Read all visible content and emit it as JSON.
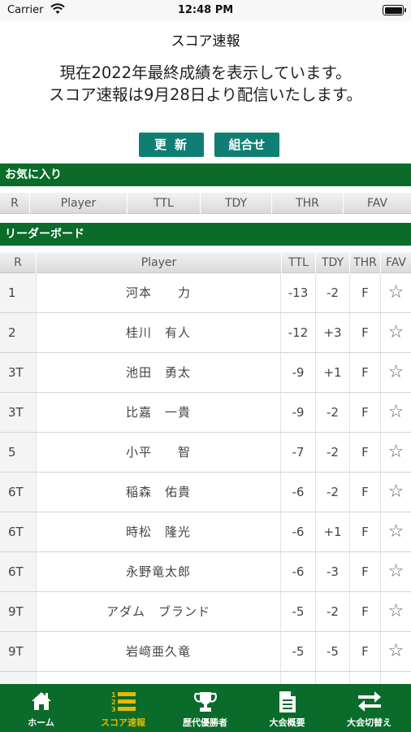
{
  "status_bar": {
    "carrier": "Carrier",
    "time": "12:48 PM"
  },
  "page": {
    "title": "スコア速報",
    "notice_line1": "現在2022年最終成績を表示しています。",
    "notice_line2": "スコア速報は9月28日より配信いたします。"
  },
  "buttons": {
    "refresh": "更新",
    "combination": "組合せ"
  },
  "favorites": {
    "title": "お気に入り",
    "columns": {
      "rank": "R",
      "player": "Player",
      "ttl": "TTL",
      "tdy": "TDY",
      "thr": "THR",
      "fav": "FAV"
    }
  },
  "leaderboard": {
    "title": "リーダーボード",
    "columns": {
      "rank": "R",
      "player": "Player",
      "ttl": "TTL",
      "tdy": "TDY",
      "thr": "THR",
      "fav": "FAV"
    },
    "rows": [
      {
        "rank": "1",
        "player": "河本　　力",
        "ttl": "-13",
        "tdy": "-2",
        "thr": "F",
        "fav": "☆"
      },
      {
        "rank": "2",
        "player": "桂川　有人",
        "ttl": "-12",
        "tdy": "+3",
        "thr": "F",
        "fav": "☆"
      },
      {
        "rank": "3T",
        "player": "池田　勇太",
        "ttl": "-9",
        "tdy": "+1",
        "thr": "F",
        "fav": "☆"
      },
      {
        "rank": "3T",
        "player": "比嘉　一貴",
        "ttl": "-9",
        "tdy": "-2",
        "thr": "F",
        "fav": "☆"
      },
      {
        "rank": "5",
        "player": "小平　　智",
        "ttl": "-7",
        "tdy": "-2",
        "thr": "F",
        "fav": "☆"
      },
      {
        "rank": "6T",
        "player": "稲森　佑貴",
        "ttl": "-6",
        "tdy": "-2",
        "thr": "F",
        "fav": "☆"
      },
      {
        "rank": "6T",
        "player": "時松　隆光",
        "ttl": "-6",
        "tdy": "+1",
        "thr": "F",
        "fav": "☆"
      },
      {
        "rank": "6T",
        "player": "永野竜太郎",
        "ttl": "-6",
        "tdy": "-3",
        "thr": "F",
        "fav": "☆"
      },
      {
        "rank": "9T",
        "player": "アダム　ブランド",
        "ttl": "-5",
        "tdy": "-2",
        "thr": "F",
        "fav": "☆"
      },
      {
        "rank": "9T",
        "player": "岩﨑亜久竜",
        "ttl": "-5",
        "tdy": "-5",
        "thr": "F",
        "fav": "☆"
      },
      {
        "rank": "",
        "player": "",
        "ttl": "",
        "tdy": "",
        "thr": "",
        "fav": ""
      }
    ]
  },
  "tabbar": {
    "items": [
      {
        "label": "ホーム",
        "icon": "home-icon"
      },
      {
        "label": "スコア速報",
        "icon": "ranking-list-icon"
      },
      {
        "label": "歴代優勝者",
        "icon": "trophy-icon"
      },
      {
        "label": "大会概要",
        "icon": "document-icon"
      },
      {
        "label": "大会切替え",
        "icon": "switch-arrows-icon"
      }
    ],
    "active_index": 1
  },
  "colors": {
    "section_green": "#0a6b2a",
    "button_teal": "#0f7f74",
    "active_tab": "#e9b800"
  }
}
